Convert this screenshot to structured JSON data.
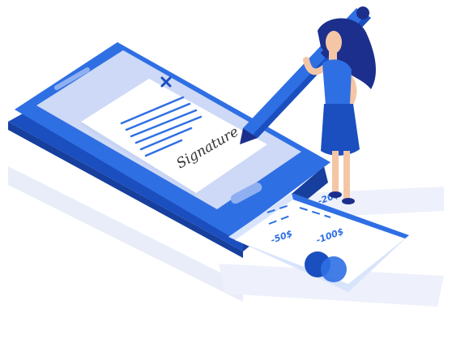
{
  "illustration": {
    "signature_text": "Signature",
    "check_amounts": [
      "-20$",
      "-50$",
      "-100$"
    ]
  },
  "colors": {
    "primary_blue": "#2f6fe4",
    "dark_blue": "#1b4fbf",
    "navy": "#1c2f8c",
    "light_blue": "#d8e4fb",
    "paper": "#ffffff",
    "shadow": "#e6eaf8",
    "skin": "#f4c6a6"
  },
  "icons": {
    "close_mark": "close-icon",
    "pen": "pen-icon"
  }
}
